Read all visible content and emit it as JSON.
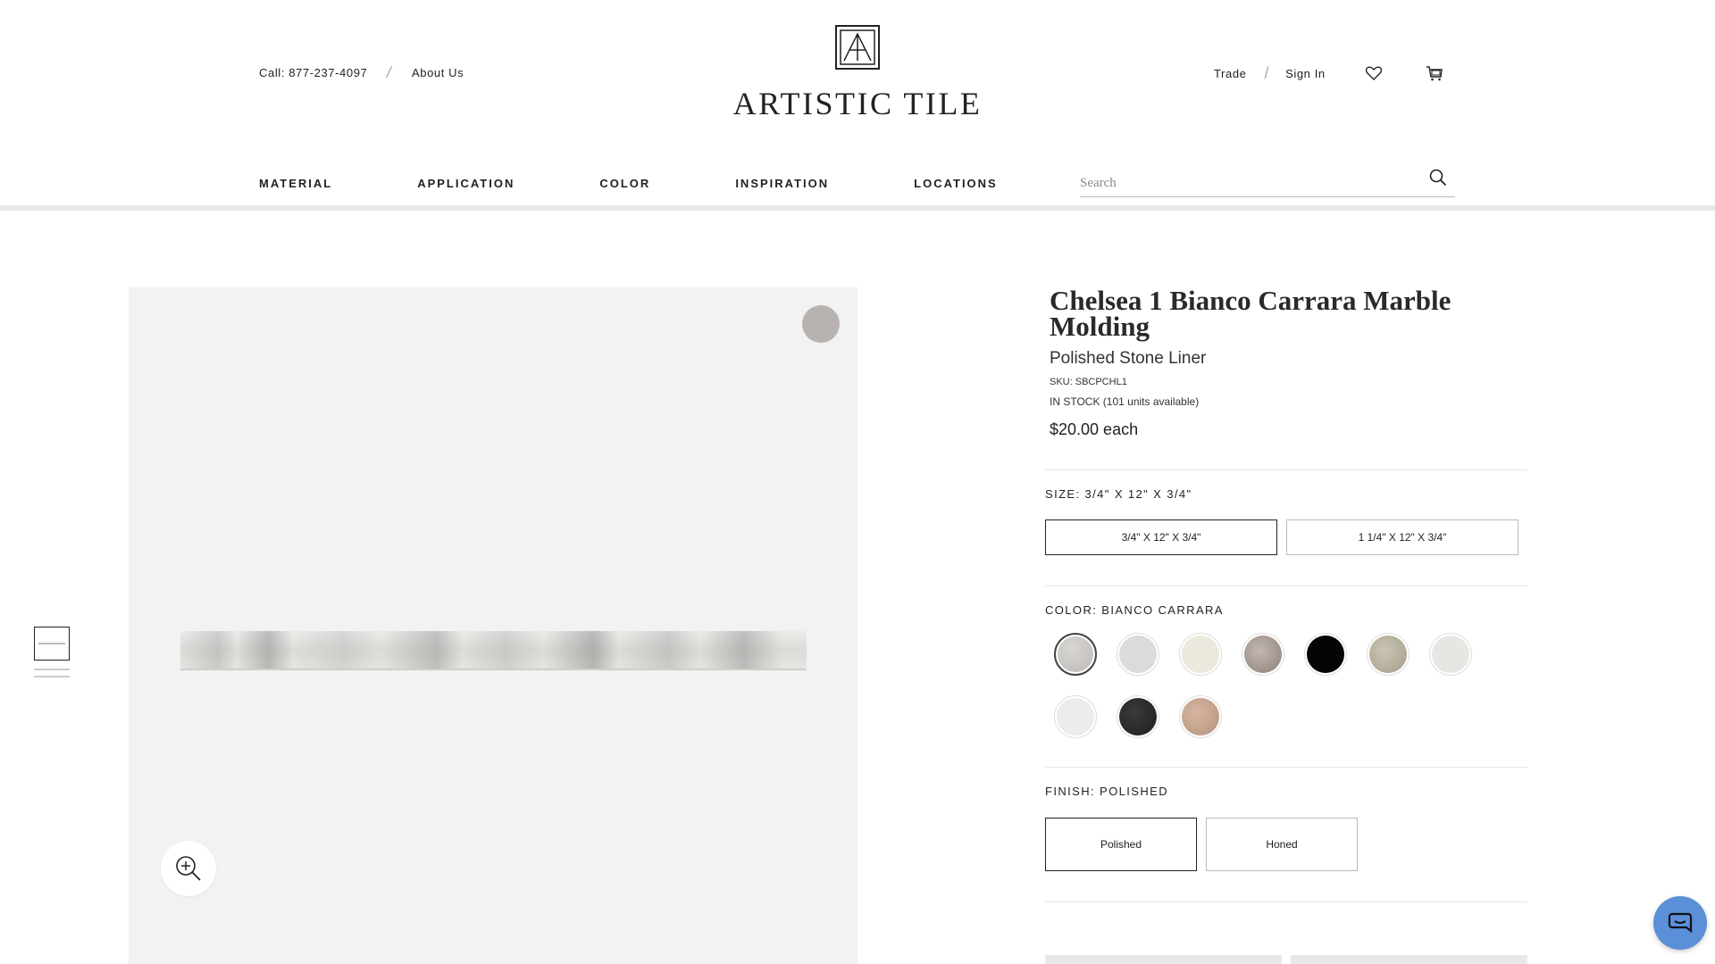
{
  "header": {
    "phone": "Call: 877-237-4097",
    "about": "About Us",
    "logo_text": "ARTISTIC TILE",
    "trade": "Trade",
    "sign_in": "Sign In",
    "wishlist_icon": "heart-icon",
    "cart_icon": "cart-icon"
  },
  "nav": {
    "items": [
      "MATERIAL",
      "APPLICATION",
      "COLOR",
      "INSPIRATION",
      "LOCATIONS"
    ]
  },
  "search": {
    "placeholder": "Search",
    "icon": "search-icon"
  },
  "gallery": {
    "zoom_icon": "zoom-in-icon"
  },
  "product": {
    "title": "Chelsea 1 Bianco Carrara Marble Molding",
    "subtitle": "Polished Stone Liner",
    "sku": "SKU: SBCPCHL1",
    "stock": "IN STOCK (101 units available)",
    "price": "$20.00 each"
  },
  "options": {
    "size_label": "SIZE: 3/4\" X 12\" X 3/4\"",
    "sizes": [
      "3/4\" X 12\" X 3/4\"",
      "1 1/4\" X 12\" X 3/4\""
    ],
    "color_label": "COLOR: BIANCO CARRARA",
    "color_swatches": [
      "#c9c7c4",
      "#dcdbd9",
      "#ebe8dd",
      "#a89d95",
      "#050505",
      "#b8b2a0",
      "#e6e6e3",
      "#ececee",
      "#2a2a2c",
      "#c9a791"
    ],
    "finish_label": "FINISH: POLISHED",
    "finishes": [
      "Polished",
      "Honed"
    ]
  },
  "chat": {
    "icon": "chat-icon"
  }
}
